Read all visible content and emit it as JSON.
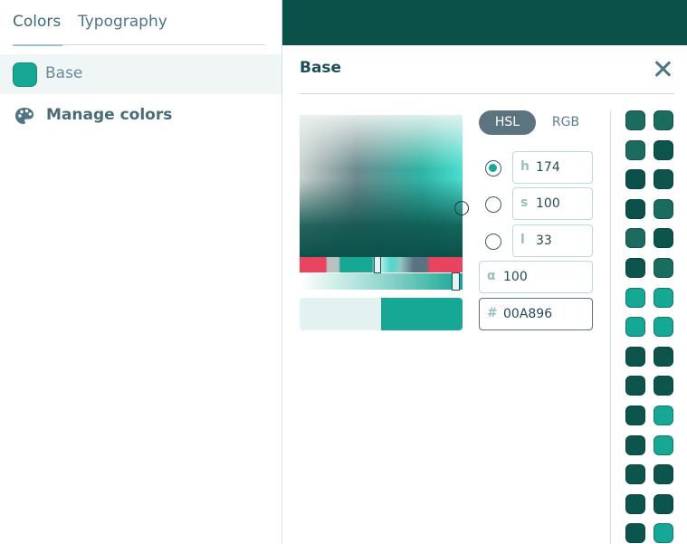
{
  "sidebar": {
    "tabs": [
      {
        "label": "Colors"
      },
      {
        "label": "Typography"
      }
    ],
    "color_item": {
      "label": "Base",
      "swatch_color": "#16a795"
    },
    "manage": {
      "label": "Manage colors",
      "icon": "palette-icon"
    }
  },
  "panel": {
    "title": "Base",
    "close_icon": "close-icon",
    "modes": {
      "hsl": "HSL",
      "rgb": "RGB",
      "selected": "HSL"
    },
    "fields": {
      "h": {
        "prefix": "h",
        "value": "174"
      },
      "s": {
        "prefix": "s",
        "value": "100"
      },
      "l": {
        "prefix": "l",
        "value": "33"
      },
      "alpha": {
        "prefix": "α",
        "value": "100"
      },
      "hex": {
        "prefix": "#",
        "value": "00A896"
      }
    },
    "selected_channel": "h",
    "preview": {
      "previous_color": "#e3f1f1",
      "current_color": "#16a795"
    }
  },
  "colors": {
    "topbar": "#0b514a",
    "accent": "#16a795",
    "dark": "#0b514a",
    "mid": "#1f6a5e"
  },
  "palette_grid": [
    [
      "#1b6b5f",
      "#1b6b5f"
    ],
    [
      "#1b6b5f",
      "#0d544c"
    ],
    [
      "#0b514a",
      "#0d544c"
    ],
    [
      "#0b514a",
      "#1b6b5f"
    ],
    [
      "#1b6b5f",
      "#0d544c"
    ],
    [
      "#0d544c",
      "#1b6b5f"
    ],
    [
      "#16a795",
      "#16a795"
    ],
    [
      "#16a795",
      "#16a795"
    ],
    [
      "#0d544c",
      "#0d544c"
    ],
    [
      "#0d544c",
      "#0d544c"
    ],
    [
      "#0d544c",
      "#16a795"
    ],
    [
      "#0d544c",
      "#16a795"
    ],
    [
      "#0d544c",
      "#0d544c"
    ],
    [
      "#0d544c",
      "#0d544c"
    ],
    [
      "#0d544c",
      "#16a795"
    ]
  ]
}
